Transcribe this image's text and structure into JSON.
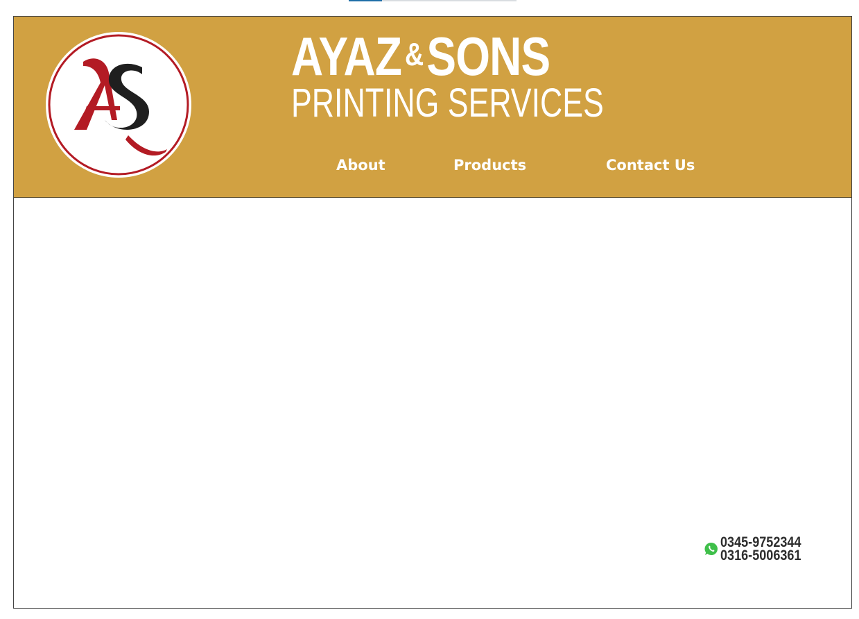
{
  "top_progress": {
    "fraction": 0.2,
    "color": "#1f6fa8"
  },
  "header": {
    "background": "#d1a142",
    "logo": {
      "monogram": "AS",
      "ring_color": "#b31b24"
    },
    "title": "AYAZ",
    "title_amp": "&",
    "title_rest": "SONS",
    "subtitle": "PRINTING SERVICES"
  },
  "nav": {
    "items": [
      {
        "label": "About"
      },
      {
        "label": "Products"
      },
      {
        "label": "Contact Us"
      }
    ]
  },
  "contact": {
    "icon": "whatsapp-icon",
    "phones": [
      "0345-9752344",
      "0316-5006361"
    ]
  }
}
